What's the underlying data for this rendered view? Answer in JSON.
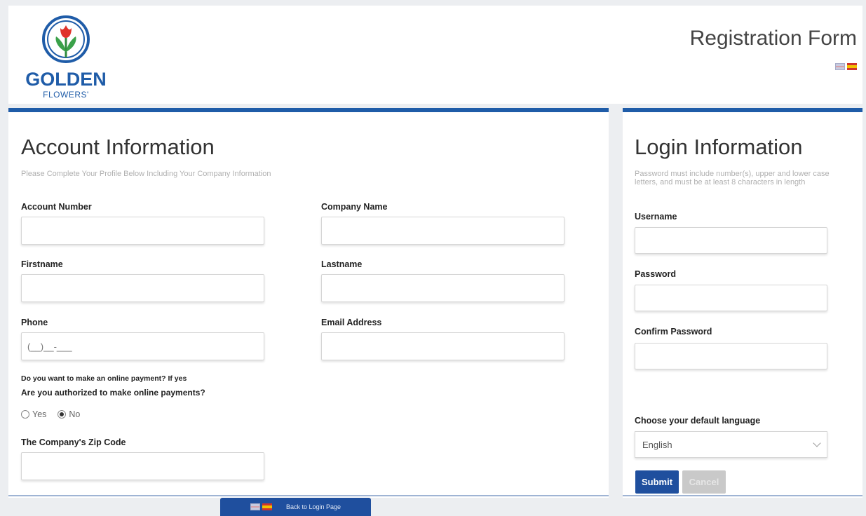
{
  "header": {
    "logo_line1": "GOLDEN",
    "logo_line2": "FLOWERS'",
    "page_title": "Registration Form"
  },
  "account": {
    "title": "Account Information",
    "subtitle": "Please Complete Your Profile Below Including Your Company Information",
    "fields": {
      "account_number": {
        "label": "Account Number",
        "value": ""
      },
      "company_name": {
        "label": "Company Name",
        "value": ""
      },
      "firstname": {
        "label": "Firstname",
        "value": ""
      },
      "lastname": {
        "label": "Lastname",
        "value": ""
      },
      "phone": {
        "label": "Phone",
        "placeholder": "(__)__-___"
      },
      "email": {
        "label": "Email Address",
        "value": ""
      },
      "zip": {
        "label": "The Company's Zip Code",
        "value": ""
      }
    },
    "payment_question_1": "Do you want to make an online payment? If yes",
    "payment_question_2": "Are you authorized to make online payments?",
    "radio_yes": "Yes",
    "radio_no": "No",
    "radio_selected": "No"
  },
  "login": {
    "title": "Login Information",
    "subtitle": "Password must include number(s), upper and lower case letters, and must be at least 8 characters in length",
    "fields": {
      "username": {
        "label": "Username",
        "value": ""
      },
      "password": {
        "label": "Password",
        "value": ""
      },
      "confirm_password": {
        "label": "Confirm Password",
        "value": ""
      }
    },
    "language_label": "Choose your default language",
    "language_value": "English",
    "submit_label": "Submit",
    "cancel_label": "Cancel"
  },
  "footer": {
    "back_link": "Back to Login Page"
  },
  "colors": {
    "brand_blue": "#1f5ca8",
    "button_blue": "#1f4f9e",
    "page_bg": "#eceef1"
  }
}
